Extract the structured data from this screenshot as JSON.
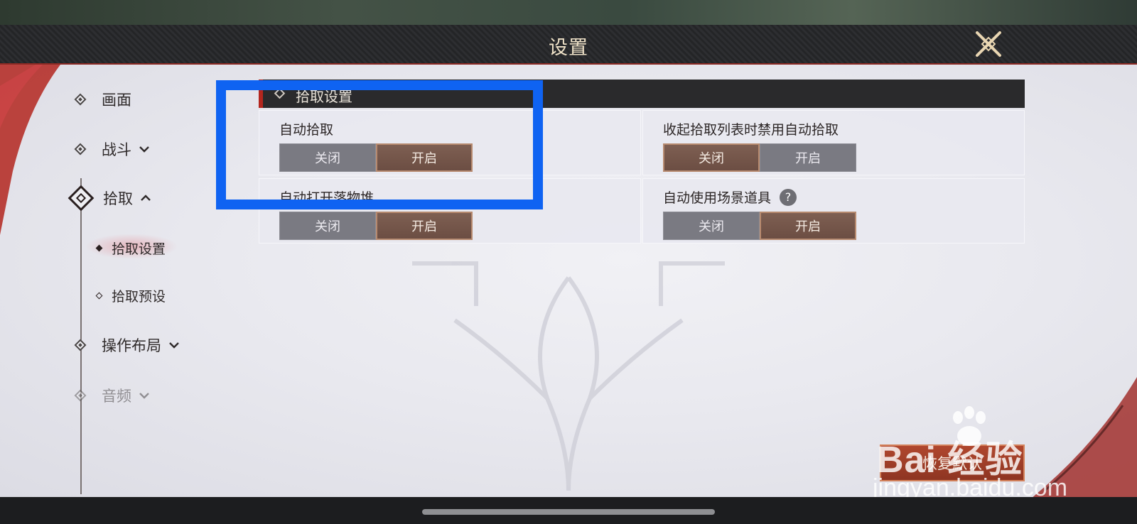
{
  "header": {
    "title": "设置"
  },
  "nav": {
    "items": [
      {
        "label": "画面",
        "chevron": ""
      },
      {
        "label": "战斗",
        "chevron": "⌄"
      },
      {
        "label": "拾取",
        "chevron": "⌃"
      },
      {
        "label": "操作布局",
        "chevron": "⌄"
      },
      {
        "label": "音频",
        "chevron": "⌄"
      }
    ],
    "sub_items": [
      {
        "label": "拾取设置",
        "active": true
      },
      {
        "label": "拾取预设",
        "active": false
      }
    ]
  },
  "section": {
    "title": "拾取设置"
  },
  "settings": [
    {
      "label": "自动拾取",
      "off_label": "关闭",
      "on_label": "开启",
      "selected": "on"
    },
    {
      "label": "收起拾取列表时禁用自动拾取",
      "off_label": "关闭",
      "on_label": "开启",
      "selected": "off"
    },
    {
      "label": "自动打开落物堆",
      "off_label": "关闭",
      "on_label": "开启",
      "selected": "on"
    },
    {
      "label": "自动使用场景道具",
      "off_label": "关闭",
      "on_label": "开启",
      "selected": "on",
      "help": "?"
    }
  ],
  "restore_button": {
    "label": "恢复默认"
  },
  "watermark": {
    "brand": "Bai 经验",
    "sub": "jingyan.baidu.com"
  },
  "colors": {
    "accent_red": "#b3261e",
    "toggle_on": "#6c4e43",
    "annotation_blue": "#0f63f2"
  }
}
